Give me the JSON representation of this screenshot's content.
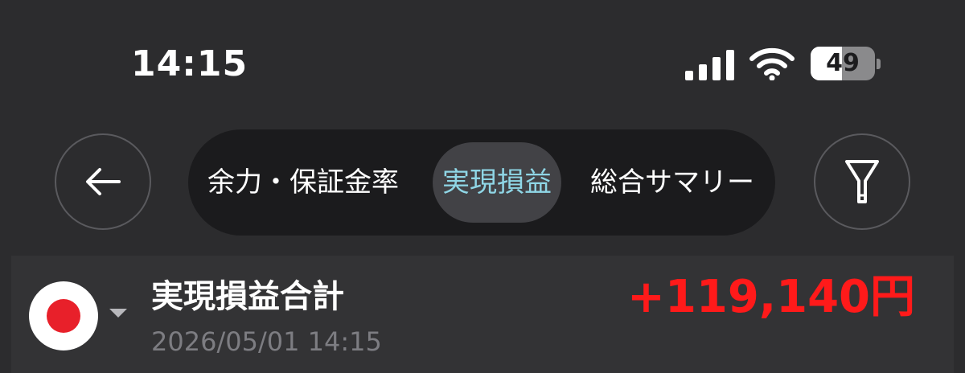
{
  "status_bar": {
    "time": "14:15",
    "battery_level": "49",
    "battery_fraction": 0.49,
    "icons": [
      "signal-icon",
      "wifi-icon",
      "battery-icon"
    ]
  },
  "nav": {
    "back_icon": "arrow-left-icon",
    "filter_icon": "filter-icon",
    "tabs": [
      {
        "label": "余力・保証金率",
        "active": false
      },
      {
        "label": "実現損益",
        "active": true
      },
      {
        "label": "総合サマリー",
        "active": false
      }
    ]
  },
  "summary": {
    "market_icon": "japan-flag-icon",
    "dropdown_icon": "caret-down-icon",
    "title": "実現損益合計",
    "datetime": "2026/05/01 14:15",
    "amount": "+119,140円"
  },
  "colors": {
    "background": "#2c2c2e",
    "active_tab_text": "#8fd6e6",
    "profit": "#ff1a1a",
    "flag_red": "#e8202a"
  }
}
